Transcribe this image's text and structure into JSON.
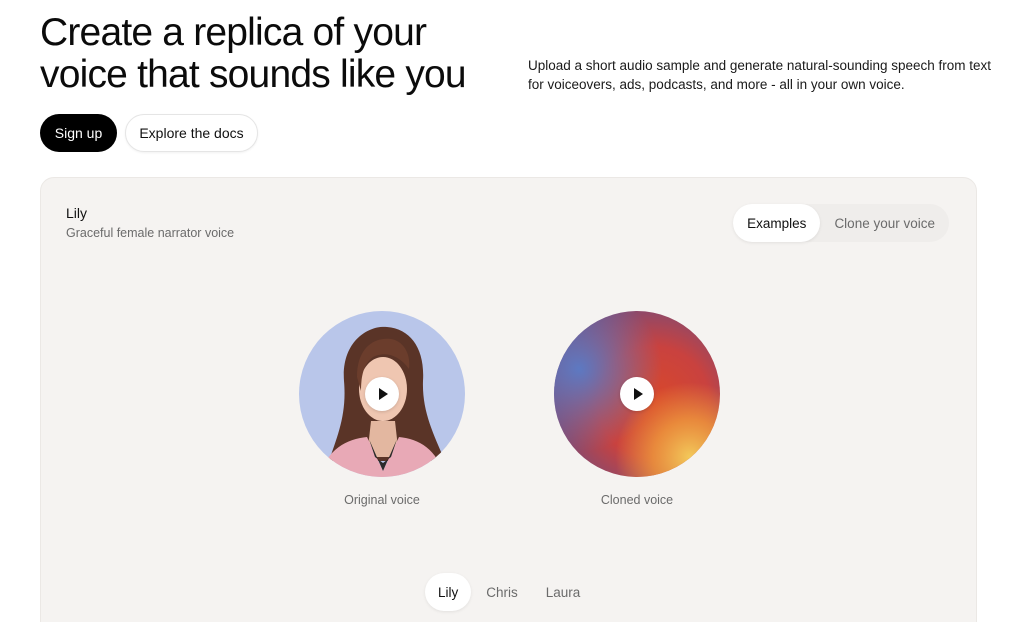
{
  "hero": {
    "title": "Create a replica of your voice that sounds like you",
    "description": "Upload a short audio sample and generate natural-sounding speech from text for voiceovers, ads, podcasts, and more - all in your own voice."
  },
  "cta": {
    "signup_label": "Sign up",
    "docs_label": "Explore the docs"
  },
  "panel": {
    "voice_name": "Lily",
    "voice_description": "Graceful female narrator voice",
    "mode_tabs": [
      {
        "label": "Examples",
        "active": true
      },
      {
        "label": "Clone your voice",
        "active": false
      }
    ],
    "original": {
      "label": "Original voice",
      "icon": "play-icon"
    },
    "cloned": {
      "label": "Cloned voice",
      "icon": "play-icon"
    },
    "speakers": [
      {
        "label": "Lily",
        "active": true
      },
      {
        "label": "Chris",
        "active": false
      },
      {
        "label": "Laura",
        "active": false
      }
    ]
  },
  "colors": {
    "primary_button": "#000000",
    "panel_bg": "#f5f3f1",
    "portrait_bg": "#b9c6ea"
  }
}
